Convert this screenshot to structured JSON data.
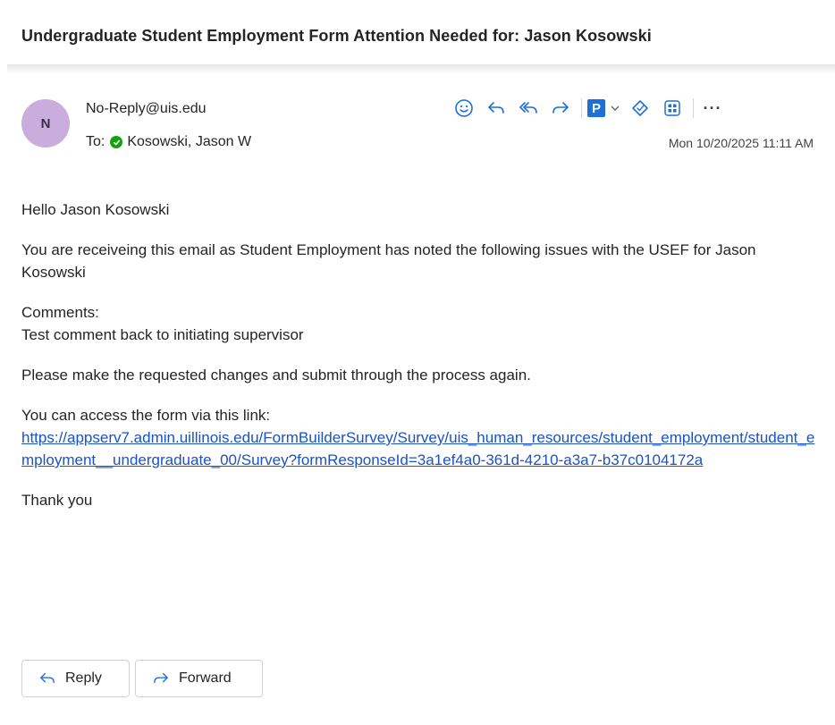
{
  "email": {
    "subject": "Undergraduate Student Employment Form Attention Needed for: Jason Kosowski",
    "sender": "No-Reply@uis.edu",
    "avatar_initial": "N",
    "avatar_color": "#c9aedd",
    "to_label": "To:",
    "recipient": "Kosowski, Jason W",
    "date": "Mon 10/20/2025 11:11 AM"
  },
  "toolbar": {
    "icons": [
      "emoji-icon",
      "reply-icon",
      "reply-all-icon",
      "forward-icon",
      "pane-app-icon",
      "chevron-down-icon",
      "tag-icon",
      "apps-icon",
      "more-icon"
    ],
    "p_label": "P",
    "more_label": "···"
  },
  "body": {
    "greeting": "Hello Jason Kosowski",
    "intro": "You are receiveing this email as Student Employment has noted the following issues with the USEF for Jason Kosowski",
    "comments_label": "Comments:",
    "comment": "Test comment back to initiating supervisor",
    "request": "Please make the requested changes and submit through the process again.",
    "link_intro": "You can access the form via this link:",
    "link": "https://appserv7.admin.uillinois.edu/FormBuilderSurvey/Survey/uis_human_resources/student_employment/student_employment__undergraduate_00/Survey?formResponseId=3a1ef4a0-361d-4210-a3a7-b37c0104172a",
    "closing": "Thank you"
  },
  "footer": {
    "reply_label": "Reply",
    "forward_label": "Forward"
  },
  "colors": {
    "link": "#1a52c9",
    "presence": "#13a10e",
    "accent": "#1f6fd6"
  }
}
